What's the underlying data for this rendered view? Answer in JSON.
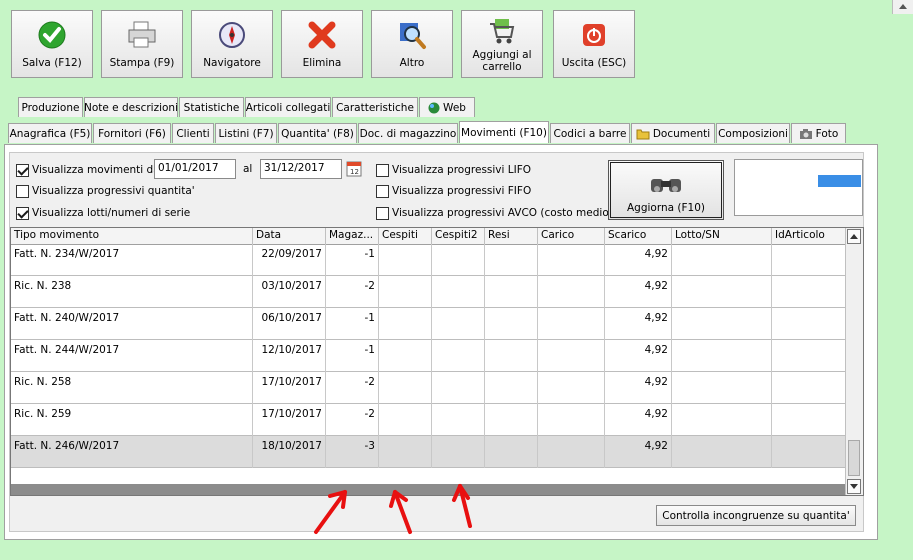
{
  "toolbar": {
    "save": "Salva (F12)",
    "print": "Stampa (F9)",
    "navigator": "Navigatore",
    "delete": "Elimina",
    "other": "Altro",
    "cart": "Aggiungi al carrello",
    "exit": "Uscita (ESC)"
  },
  "tabs_row1": [
    "Produzione",
    "Note e descrizioni",
    "Statistiche",
    "Articoli collegati",
    "Caratteristiche",
    "Web"
  ],
  "tabs_row2": [
    "Anagrafica (F5)",
    "Fornitori (F6)",
    "Clienti",
    "Listini (F7)",
    "Quantita' (F8)",
    "Doc. di magazzino",
    "Movimenti (F10)",
    "Codici a barre",
    "Documenti",
    "Composizioni",
    "Foto"
  ],
  "filters": {
    "show_movements": "Visualizza movimenti dal",
    "date_from": "01/01/2017",
    "al": "al",
    "date_to": "31/12/2017",
    "qty_progressive": "Visualizza progressivi quantita'",
    "lots": "Visualizza lotti/numeri di serie",
    "lifo": "Visualizza progressivi LIFO",
    "fifo": "Visualizza progressivi FIFO",
    "avco": "Visualizza progressivi AVCO (costo medio)",
    "refresh": "Aggiorna (F10)"
  },
  "grid": {
    "columns": [
      "Tipo movimento",
      "Data",
      "Magaz...",
      "Cespiti",
      "Cespiti2",
      "Resi",
      "Carico",
      "Scarico",
      "Lotto/SN",
      "IdArticolo"
    ],
    "rows": [
      {
        "tipo": "Fatt. N. 234/W/2017",
        "data": "22/09/2017",
        "magaz": "-1",
        "scarico": "4,92"
      },
      {
        "tipo": "Ric. N. 238",
        "data": "03/10/2017",
        "magaz": "-2",
        "scarico": "4,92"
      },
      {
        "tipo": "Fatt. N. 240/W/2017",
        "data": "06/10/2017",
        "magaz": "-1",
        "scarico": "4,92"
      },
      {
        "tipo": "Fatt. N. 244/W/2017",
        "data": "12/10/2017",
        "magaz": "-1",
        "scarico": "4,92"
      },
      {
        "tipo": "Ric. N. 258",
        "data": "17/10/2017",
        "magaz": "-2",
        "scarico": "4,92"
      },
      {
        "tipo": "Ric. N. 259",
        "data": "17/10/2017",
        "magaz": "-2",
        "scarico": "4,92"
      },
      {
        "tipo": "Fatt. N. 246/W/2017",
        "data": "18/10/2017",
        "magaz": "-3",
        "scarico": "4,92"
      }
    ]
  },
  "check_button": "Controlla incongruenze su quantita'",
  "colors": {
    "background": "#c6f5c6",
    "annotation": "#e81010",
    "accent": "#3a8ee6"
  }
}
